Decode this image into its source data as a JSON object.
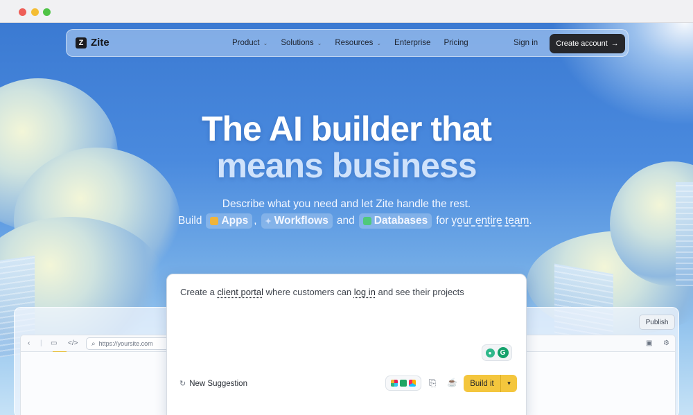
{
  "nav": {
    "logo_text": "Zite",
    "logo_mark": "Z",
    "links": [
      {
        "label": "Product",
        "has_dropdown": true
      },
      {
        "label": "Solutions",
        "has_dropdown": true
      },
      {
        "label": "Resources",
        "has_dropdown": true
      },
      {
        "label": "Enterprise",
        "has_dropdown": false
      },
      {
        "label": "Pricing",
        "has_dropdown": false
      }
    ],
    "sign_in": "Sign in",
    "create_account": "Create account",
    "create_arrow": "→"
  },
  "hero": {
    "title_line1": "The AI builder that",
    "title_line2": "means business",
    "subtitle": "Describe what you need and let Zite handle the rest.",
    "build_prefix": "Build",
    "chips": [
      {
        "label": "Apps",
        "icon": "cube-icon",
        "color": "#f0b43a"
      },
      {
        "label": "Workflows",
        "icon": "sparkle-icon",
        "color": "#a9c4f2"
      },
      {
        "label": "Databases",
        "icon": "grid-icon",
        "color": "#4fc97a"
      }
    ],
    "comma": ",",
    "and": "and",
    "for_text": "for",
    "team_text": "your entire team",
    "period": "."
  },
  "app_preview": {
    "publish_label": "Publish",
    "url": "https://yoursite.com"
  },
  "prompt": {
    "text_before": "Create a",
    "kw1": "client portal",
    "text_mid": "where customers can",
    "kw2": "log in",
    "text_after": "and see their projects",
    "new_suggestion": "New Suggestion",
    "build_label": "Build it",
    "accent_color": "#f4c63d"
  }
}
